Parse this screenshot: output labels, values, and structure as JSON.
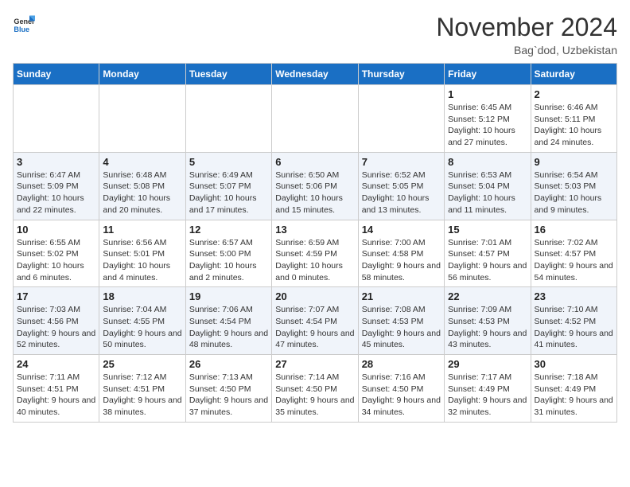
{
  "header": {
    "logo_general": "General",
    "logo_blue": "Blue",
    "month_title": "November 2024",
    "location": "Bag`dod, Uzbekistan"
  },
  "weekdays": [
    "Sunday",
    "Monday",
    "Tuesday",
    "Wednesday",
    "Thursday",
    "Friday",
    "Saturday"
  ],
  "weeks": [
    [
      {
        "day": "",
        "info": ""
      },
      {
        "day": "",
        "info": ""
      },
      {
        "day": "",
        "info": ""
      },
      {
        "day": "",
        "info": ""
      },
      {
        "day": "",
        "info": ""
      },
      {
        "day": "1",
        "info": "Sunrise: 6:45 AM\nSunset: 5:12 PM\nDaylight: 10 hours and 27 minutes."
      },
      {
        "day": "2",
        "info": "Sunrise: 6:46 AM\nSunset: 5:11 PM\nDaylight: 10 hours and 24 minutes."
      }
    ],
    [
      {
        "day": "3",
        "info": "Sunrise: 6:47 AM\nSunset: 5:09 PM\nDaylight: 10 hours and 22 minutes."
      },
      {
        "day": "4",
        "info": "Sunrise: 6:48 AM\nSunset: 5:08 PM\nDaylight: 10 hours and 20 minutes."
      },
      {
        "day": "5",
        "info": "Sunrise: 6:49 AM\nSunset: 5:07 PM\nDaylight: 10 hours and 17 minutes."
      },
      {
        "day": "6",
        "info": "Sunrise: 6:50 AM\nSunset: 5:06 PM\nDaylight: 10 hours and 15 minutes."
      },
      {
        "day": "7",
        "info": "Sunrise: 6:52 AM\nSunset: 5:05 PM\nDaylight: 10 hours and 13 minutes."
      },
      {
        "day": "8",
        "info": "Sunrise: 6:53 AM\nSunset: 5:04 PM\nDaylight: 10 hours and 11 minutes."
      },
      {
        "day": "9",
        "info": "Sunrise: 6:54 AM\nSunset: 5:03 PM\nDaylight: 10 hours and 9 minutes."
      }
    ],
    [
      {
        "day": "10",
        "info": "Sunrise: 6:55 AM\nSunset: 5:02 PM\nDaylight: 10 hours and 6 minutes."
      },
      {
        "day": "11",
        "info": "Sunrise: 6:56 AM\nSunset: 5:01 PM\nDaylight: 10 hours and 4 minutes."
      },
      {
        "day": "12",
        "info": "Sunrise: 6:57 AM\nSunset: 5:00 PM\nDaylight: 10 hours and 2 minutes."
      },
      {
        "day": "13",
        "info": "Sunrise: 6:59 AM\nSunset: 4:59 PM\nDaylight: 10 hours and 0 minutes."
      },
      {
        "day": "14",
        "info": "Sunrise: 7:00 AM\nSunset: 4:58 PM\nDaylight: 9 hours and 58 minutes."
      },
      {
        "day": "15",
        "info": "Sunrise: 7:01 AM\nSunset: 4:57 PM\nDaylight: 9 hours and 56 minutes."
      },
      {
        "day": "16",
        "info": "Sunrise: 7:02 AM\nSunset: 4:57 PM\nDaylight: 9 hours and 54 minutes."
      }
    ],
    [
      {
        "day": "17",
        "info": "Sunrise: 7:03 AM\nSunset: 4:56 PM\nDaylight: 9 hours and 52 minutes."
      },
      {
        "day": "18",
        "info": "Sunrise: 7:04 AM\nSunset: 4:55 PM\nDaylight: 9 hours and 50 minutes."
      },
      {
        "day": "19",
        "info": "Sunrise: 7:06 AM\nSunset: 4:54 PM\nDaylight: 9 hours and 48 minutes."
      },
      {
        "day": "20",
        "info": "Sunrise: 7:07 AM\nSunset: 4:54 PM\nDaylight: 9 hours and 47 minutes."
      },
      {
        "day": "21",
        "info": "Sunrise: 7:08 AM\nSunset: 4:53 PM\nDaylight: 9 hours and 45 minutes."
      },
      {
        "day": "22",
        "info": "Sunrise: 7:09 AM\nSunset: 4:53 PM\nDaylight: 9 hours and 43 minutes."
      },
      {
        "day": "23",
        "info": "Sunrise: 7:10 AM\nSunset: 4:52 PM\nDaylight: 9 hours and 41 minutes."
      }
    ],
    [
      {
        "day": "24",
        "info": "Sunrise: 7:11 AM\nSunset: 4:51 PM\nDaylight: 9 hours and 40 minutes."
      },
      {
        "day": "25",
        "info": "Sunrise: 7:12 AM\nSunset: 4:51 PM\nDaylight: 9 hours and 38 minutes."
      },
      {
        "day": "26",
        "info": "Sunrise: 7:13 AM\nSunset: 4:50 PM\nDaylight: 9 hours and 37 minutes."
      },
      {
        "day": "27",
        "info": "Sunrise: 7:14 AM\nSunset: 4:50 PM\nDaylight: 9 hours and 35 minutes."
      },
      {
        "day": "28",
        "info": "Sunrise: 7:16 AM\nSunset: 4:50 PM\nDaylight: 9 hours and 34 minutes."
      },
      {
        "day": "29",
        "info": "Sunrise: 7:17 AM\nSunset: 4:49 PM\nDaylight: 9 hours and 32 minutes."
      },
      {
        "day": "30",
        "info": "Sunrise: 7:18 AM\nSunset: 4:49 PM\nDaylight: 9 hours and 31 minutes."
      }
    ]
  ]
}
